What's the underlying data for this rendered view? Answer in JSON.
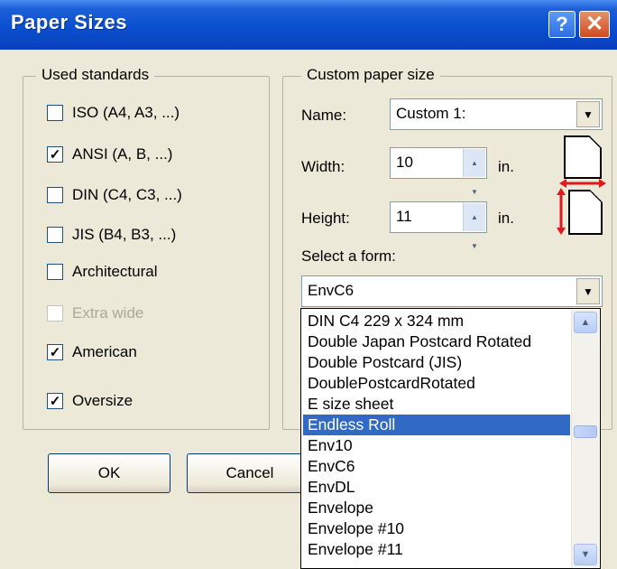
{
  "title": "Paper Sizes",
  "title_buttons": {
    "help": "?",
    "close": "✕"
  },
  "used_standards": {
    "legend": "Used standards",
    "items": [
      {
        "label": "ISO (A4, A3, ...)",
        "checked": false,
        "enabled": true,
        "mark": ""
      },
      {
        "label": "ANSI (A, B, ...)",
        "checked": true,
        "enabled": true,
        "mark": "✓"
      },
      {
        "label": "DIN (C4, C3, ...)",
        "checked": false,
        "enabled": true,
        "mark": ""
      },
      {
        "label": "JIS (B4, B3, ...)",
        "checked": false,
        "enabled": true,
        "mark": ""
      },
      {
        "label": "Architectural",
        "checked": false,
        "enabled": true,
        "mark": ""
      },
      {
        "label": "Extra wide",
        "checked": false,
        "enabled": false,
        "mark": ""
      },
      {
        "label": "American",
        "checked": true,
        "enabled": true,
        "mark": "✓"
      },
      {
        "label": "Oversize",
        "checked": true,
        "enabled": true,
        "mark": "✓"
      }
    ]
  },
  "custom": {
    "legend": "Custom paper size",
    "name_label": "Name:",
    "name_value": "Custom 1:",
    "width_label": "Width:",
    "width_value": "10",
    "width_unit": "in.",
    "height_label": "Height:",
    "height_value": "11",
    "height_unit": "in.",
    "form_label": "Select a form:",
    "form_value": "EnvC6"
  },
  "buttons": {
    "ok": "OK",
    "cancel": "Cancel"
  },
  "form_list": {
    "items": [
      "DIN C4 229 x 324 mm",
      "Double Japan Postcard Rotated",
      "Double Postcard (JIS)",
      "DoublePostcardRotated",
      "E size sheet",
      "Endless Roll",
      "Env10",
      "EnvC6",
      "EnvDL",
      "Envelope",
      "Envelope #10",
      "Envelope #11"
    ],
    "selected": "Endless Roll"
  },
  "icons": {
    "dropdown": "chevron-down-icon",
    "spin": "spin-icon",
    "scroll_up": "scroll-up-icon",
    "scroll_down": "scroll-down-icon"
  },
  "colors": {
    "title_bar": "#0a4fd0",
    "selection": "#316ac5",
    "height_arrow": "#e0191d"
  }
}
